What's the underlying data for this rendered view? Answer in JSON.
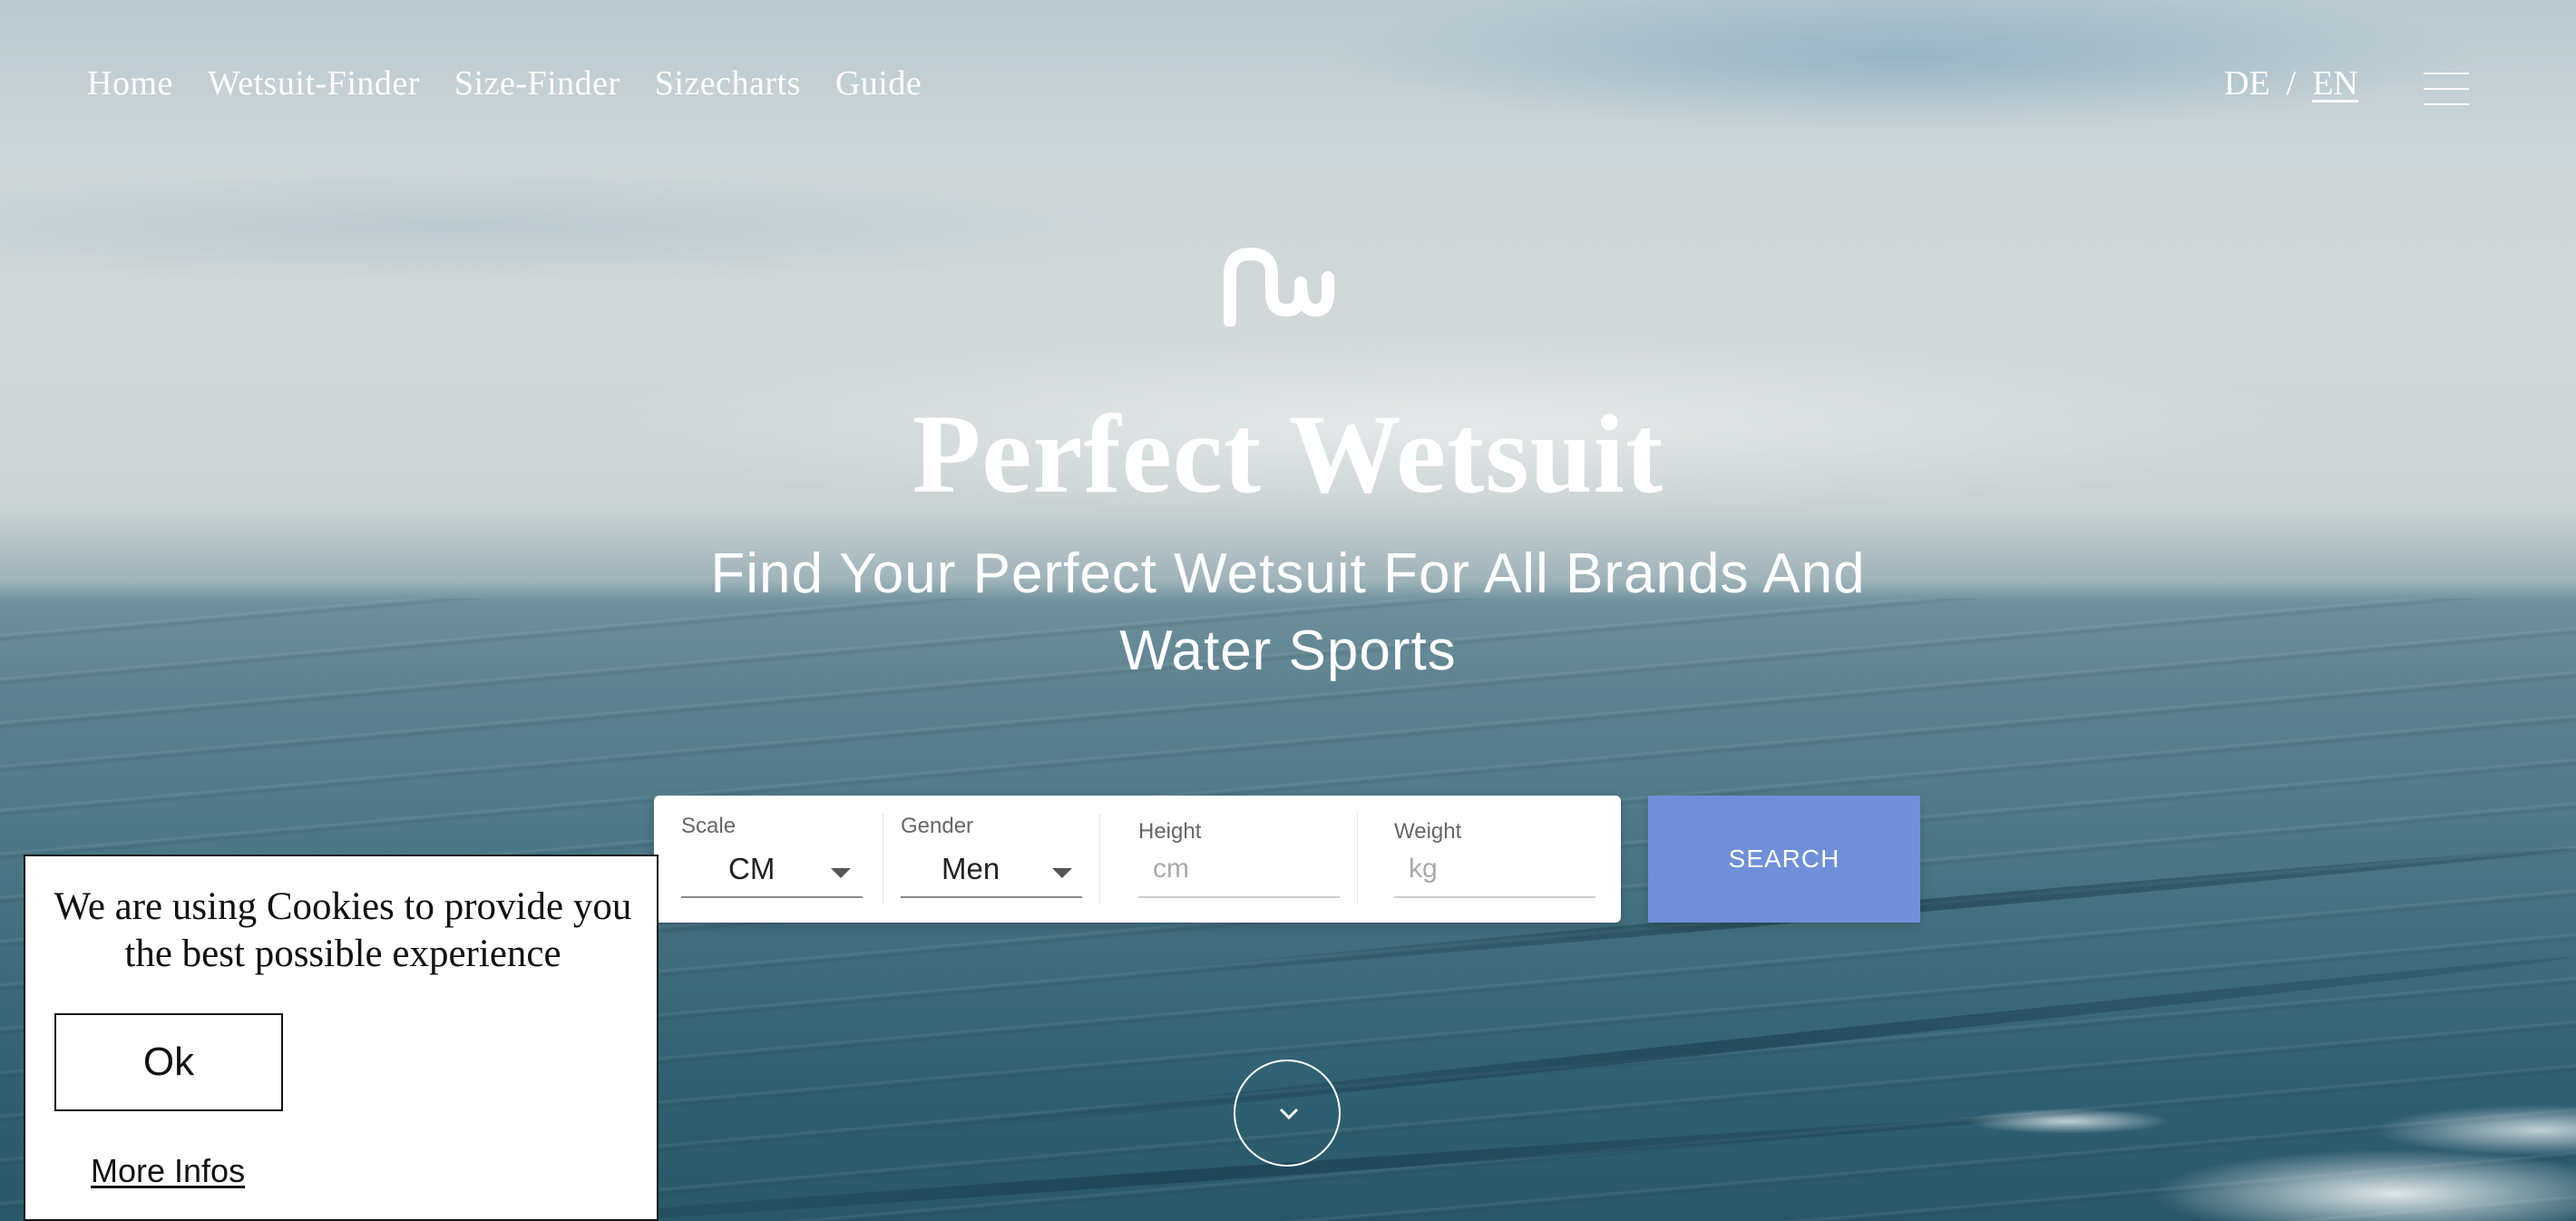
{
  "nav": {
    "items": [
      {
        "label": "Home"
      },
      {
        "label": "Wetsuit-Finder"
      },
      {
        "label": "Size-Finder"
      },
      {
        "label": "Sizecharts"
      },
      {
        "label": "Guide"
      }
    ]
  },
  "language": {
    "de": "DE",
    "separator": "/",
    "en": "EN",
    "active": "EN"
  },
  "hero": {
    "logo": "nw-logo",
    "title": "Perfect Wetsuit",
    "subtitle": "Find Your Perfect Wetsuit For All Brands And Water Sports"
  },
  "search_form": {
    "scale": {
      "label": "Scale",
      "value": "CM"
    },
    "gender": {
      "label": "Gender",
      "value": "Men"
    },
    "height": {
      "label": "Height",
      "placeholder": "cm",
      "value": ""
    },
    "weight": {
      "label": "Weight",
      "placeholder": "kg",
      "value": ""
    },
    "submit_label": "SEARCH"
  },
  "cookie_banner": {
    "message": "We are using Cookies to provide you the best possible experience",
    "ok_label": "Ok",
    "more_label": "More Infos"
  },
  "colors": {
    "accent": "#6f90d8",
    "text_light": "#ffffff"
  }
}
